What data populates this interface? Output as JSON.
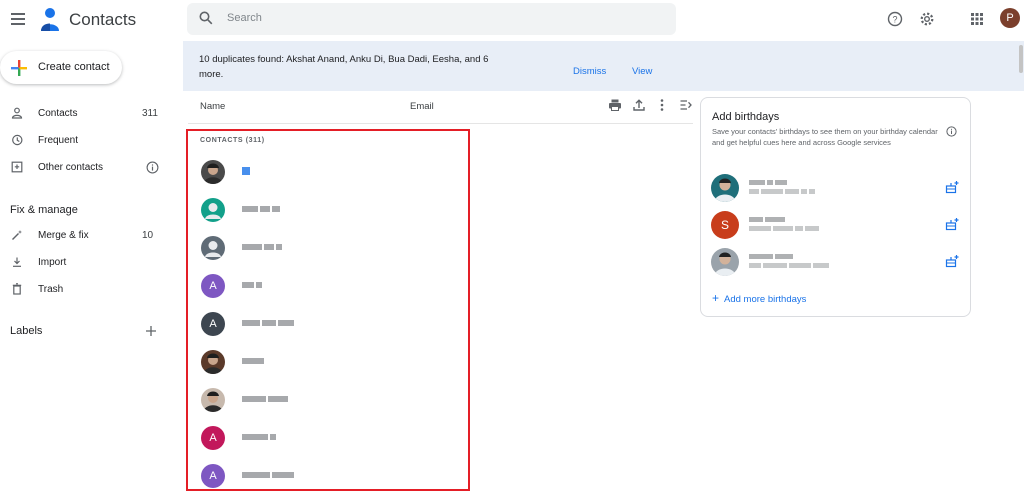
{
  "header": {
    "title": "Contacts",
    "search_placeholder": "Search",
    "avatar_letter": "P",
    "avatar_color": "#7b3f2c"
  },
  "sidebar": {
    "create_label": "Create contact",
    "items": [
      {
        "label": "Contacts",
        "count": "311",
        "icon": "person-icon"
      },
      {
        "label": "Frequent",
        "count": "",
        "icon": "history-icon"
      },
      {
        "label": "Other contacts",
        "count": "",
        "icon": "inbox-add-icon"
      }
    ],
    "fix_title": "Fix & manage",
    "fix_items": [
      {
        "label": "Merge & fix",
        "count": "10",
        "icon": "magic-wand-icon"
      },
      {
        "label": "Import",
        "count": "",
        "icon": "download-icon"
      },
      {
        "label": "Trash",
        "count": "",
        "icon": "trash-icon"
      }
    ],
    "labels_title": "Labels"
  },
  "banner": {
    "message": "10 duplicates found: Akshat Anand, Anku Di, Bua Dadi, Eesha, and 6 more.",
    "dismiss": "Dismiss",
    "view": "View"
  },
  "columns": {
    "name": "Name",
    "email": "Email"
  },
  "list": {
    "title": "CONTACTS (311)",
    "rows": [
      {
        "avatar": "photo",
        "letter": "",
        "color": "#4a4a4a"
      },
      {
        "avatar": "default",
        "letter": "",
        "color": "#12a08a"
      },
      {
        "avatar": "default",
        "letter": "",
        "color": "#5f6b76"
      },
      {
        "avatar": "letter",
        "letter": "A",
        "color": "#7e57c2"
      },
      {
        "avatar": "letter",
        "letter": "A",
        "color": "#3d4650"
      },
      {
        "avatar": "photo",
        "letter": "",
        "color": "#5b3a2a"
      },
      {
        "avatar": "photo",
        "letter": "",
        "color": "#c7b9ad"
      },
      {
        "avatar": "letter",
        "letter": "A",
        "color": "#c2185b"
      },
      {
        "avatar": "letter",
        "letter": "A",
        "color": "#7e57c2"
      }
    ]
  },
  "birthdays": {
    "title": "Add birthdays",
    "description": "Save your contacts' birthdays to see them on your birthday calendar and get helpful cues here and across Google services",
    "rows": [
      {
        "avatar": "photo",
        "letter": "",
        "color": "#1f6f7a"
      },
      {
        "avatar": "letter",
        "letter": "S",
        "color": "#c83d1b"
      },
      {
        "avatar": "photo",
        "letter": "",
        "color": "#9aa3ab"
      }
    ],
    "add_more": "Add more birthdays"
  },
  "colors": {
    "accent": "#1a73e8",
    "banner_bg": "#e8eef7",
    "highlight": "#e41e26"
  }
}
